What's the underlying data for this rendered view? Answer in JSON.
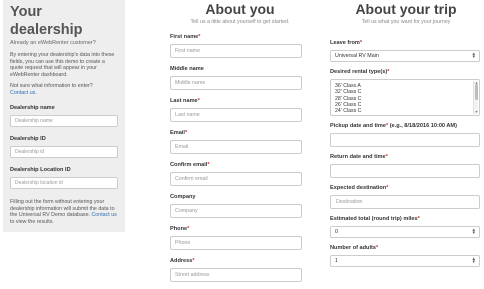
{
  "dealership": {
    "title": "Your dealership",
    "subtitle": "Already an eWebRenter customer?",
    "intro": "By entering your dealership's data into these fields, you can use this demo to create a quote request that will appear in your eWebRenter dashboard.",
    "not_sure": "Not sure what information to enter?",
    "contact_link": "Contact us.",
    "fields": [
      {
        "label": "Dealership name",
        "placeholder": "Dealership name"
      },
      {
        "label": "Dealership ID",
        "placeholder": "Dealership id"
      },
      {
        "label": "Dealership Location ID",
        "placeholder": "Dealership location id"
      }
    ],
    "footer_text": "Filling out the form without entering your dealership information will submit the data to the Universal RV Demo database.",
    "footer_link": "Contact us",
    "footer_tail": " to view the results."
  },
  "about_you": {
    "title": "About you",
    "subtitle": "Tell us a little about yourself to get started.",
    "fields": [
      {
        "label": "First name",
        "required": "*",
        "placeholder": "First name"
      },
      {
        "label": "Middle name",
        "required": "",
        "placeholder": "Middle name"
      },
      {
        "label": "Last name",
        "required": "*",
        "placeholder": "Last name"
      },
      {
        "label": "Email",
        "required": "*",
        "placeholder": "Email"
      },
      {
        "label": "Confirm email",
        "required": "*",
        "placeholder": "Confirm email"
      },
      {
        "label": "Company",
        "required": "",
        "placeholder": "Company"
      },
      {
        "label": "Phone",
        "required": "*",
        "placeholder": "Phone"
      },
      {
        "label": "Address",
        "required": "*",
        "placeholder": "Street address"
      }
    ]
  },
  "about_trip": {
    "title": "About your trip",
    "subtitle": "Tell us what you want for your journey",
    "leave_from": {
      "label": "Leave from",
      "required": "*",
      "value": "Universal RV Main"
    },
    "rental_types": {
      "label": "Desired rental type(s)",
      "required": "*",
      "options": [
        "36' Class A",
        "32' Class C",
        "28' Class C",
        "26' Class C",
        "24' Class C"
      ]
    },
    "pickup": {
      "label": "Pickup date and time",
      "required": "*",
      "hint": " (e.g., 8/18/2016 10:00 AM)",
      "value": ""
    },
    "return": {
      "label": "Return date and time",
      "required": "*",
      "value": ""
    },
    "destination": {
      "label": "Expected destination",
      "required": "*",
      "placeholder": "Destination"
    },
    "miles": {
      "label": "Estimated total (round trip) miles",
      "required": "*",
      "value": "0"
    },
    "adults": {
      "label": "Number of adults",
      "required": "*",
      "value": "1"
    }
  }
}
